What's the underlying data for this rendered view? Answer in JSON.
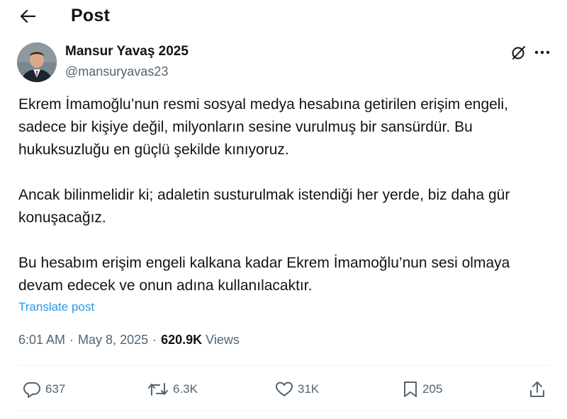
{
  "header": {
    "title": "Post"
  },
  "author": {
    "name": "Mansur Yavaş 2025",
    "handle": "@mansuryavas23"
  },
  "post": {
    "paragraphs": [
      "Ekrem İmamoğlu’nun resmi sosyal medya hesabına getirilen erişim engeli, sadece bir kişiye değil, milyonların sesine vurulmuş bir sansürdür. Bu hukuksuzluğu en güçlü şekilde kınıyoruz.",
      "Ancak bilinmelidir ki; adaletin susturulmak istendiği her yerde, biz daha gür konuşacağız.",
      "Bu hesabım erişim engeli kalkana kadar Ekrem İmamoğlu’nun sesi olmaya devam edecek ve onun adına kullanılacaktır."
    ],
    "translate_label": "Translate post"
  },
  "meta": {
    "time": "6:01 AM",
    "separator": "·",
    "date": "May 8, 2025",
    "views_count": "620.9K",
    "views_label": "Views"
  },
  "actions": {
    "replies": "637",
    "reposts": "6.3K",
    "likes": "31K",
    "bookmarks": "205"
  },
  "icons": {
    "back": "arrow-left-icon",
    "grok": "grok-icon",
    "more": "more-dots-icon",
    "reply": "reply-icon",
    "repost": "repost-icon",
    "like": "heart-icon",
    "bookmark": "bookmark-icon",
    "share": "share-icon"
  },
  "colors": {
    "text": "#0f1419",
    "secondary": "#536471",
    "link": "#1d9bf0",
    "divider": "#eff3f4"
  }
}
